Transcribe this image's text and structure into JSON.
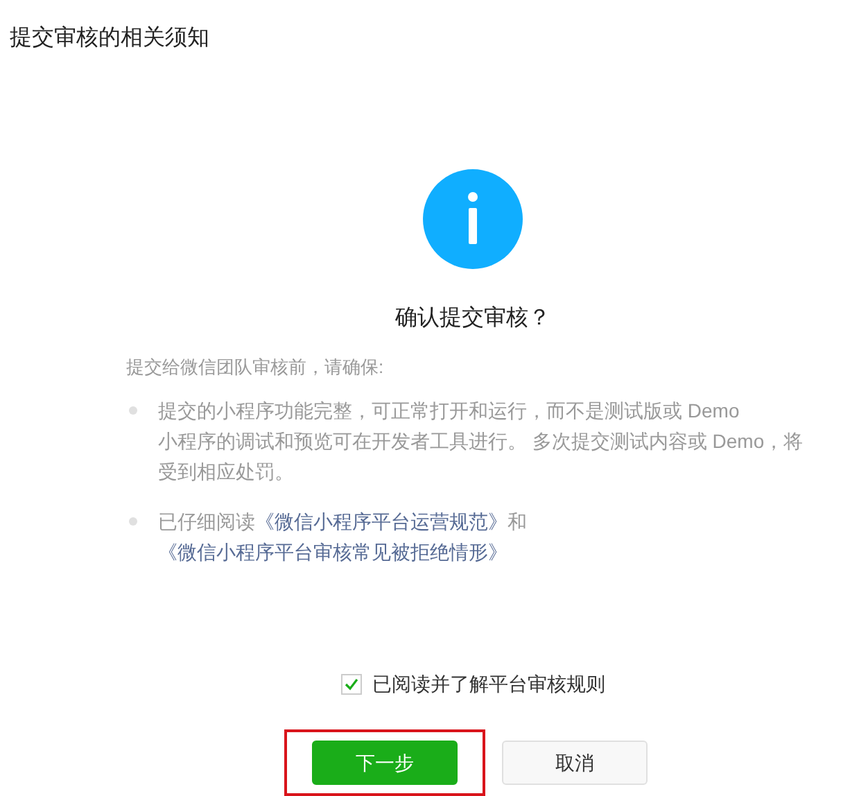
{
  "title": "提交审核的相关须知",
  "dialog": {
    "heading": "确认提交审核？",
    "intro": "提交给微信团队审核前，请确保:",
    "items": [
      {
        "parts": [
          {
            "kind": "text",
            "text": "提交的小程序功能完整，可正常打开和运行，而不是测试版或 Demo"
          },
          {
            "kind": "break"
          },
          {
            "kind": "text",
            "text": "小程序的调试和预览可在开发者工具进行。 多次提交测试内容或 Demo，将受到相应处罚。"
          }
        ]
      },
      {
        "parts": [
          {
            "kind": "text",
            "text": "已仔细阅读"
          },
          {
            "kind": "link",
            "text": "《微信小程序平台运营规范》"
          },
          {
            "kind": "text",
            "text": "和"
          },
          {
            "kind": "link",
            "text": "《微信小程序平台审核常见被拒绝情形》"
          }
        ]
      }
    ]
  },
  "agreement": {
    "label": "已阅读并了解平台审核规则",
    "checked": true
  },
  "buttons": [
    {
      "label": "下一步",
      "kind": "primary",
      "highlighted": true
    },
    {
      "label": "取消",
      "kind": "default",
      "highlighted": false
    }
  ]
}
